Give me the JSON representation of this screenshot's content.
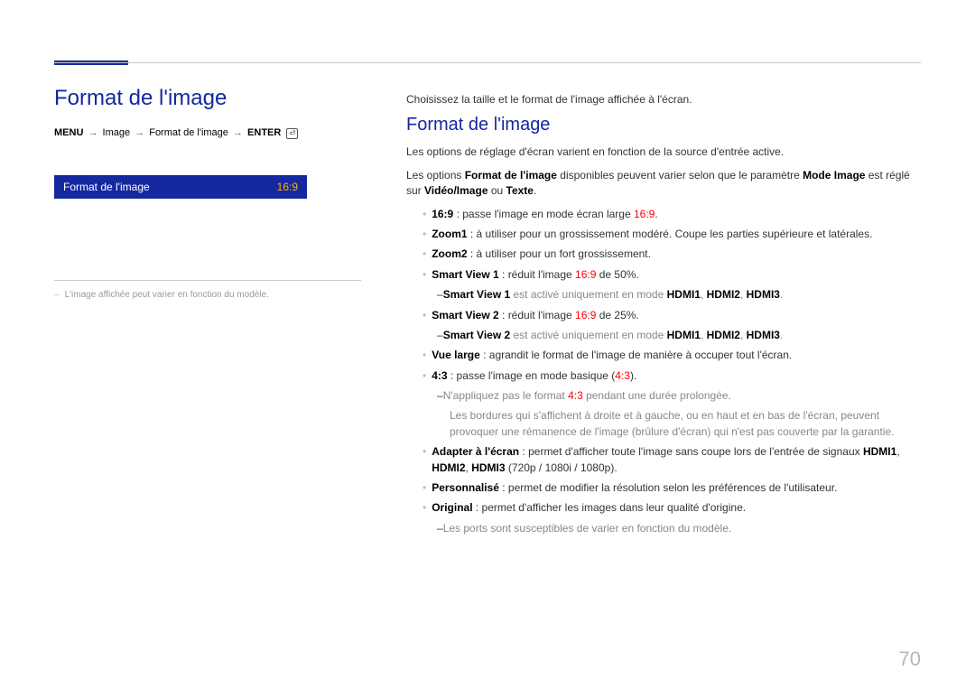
{
  "page_number": "70",
  "left": {
    "title": "Format de l'image",
    "path_menu": "MENU",
    "path_seg1": "Image",
    "path_seg2": "Format de l'image",
    "path_enter": "ENTER",
    "menu_label": "Format de l'image",
    "menu_value": "16:9",
    "note": "L'image affichée peut varier en fonction du modèle."
  },
  "right": {
    "intro": "Choisissez la taille et le format de l'image affichée à l'écran.",
    "subtitle": "Format de l'image",
    "desc": "Les options de réglage d'écran varient en fonction de la source d'entrée active.",
    "opt_line_a": "Les options ",
    "opt_line_b": "Format de l'image",
    "opt_line_c": " disponibles peuvent varier selon que le paramètre ",
    "opt_line_d": "Mode Image",
    "opt_line_e": " est réglé sur ",
    "opt_line_f": "Vidéo/Image",
    "opt_line_g": " ou ",
    "opt_line_h": "Texte",
    "opt_line_i": ".",
    "items": [
      {
        "label": "16:9",
        "text": " : passe l'image en mode écran large ",
        "val": "16:9",
        "tail": "."
      },
      {
        "label": "Zoom1",
        "text": " : à utiliser pour un grossissement modéré. Coupe les parties supérieure et latérales."
      },
      {
        "label": "Zoom2",
        "text": " : à utiliser pour un fort grossissement."
      },
      {
        "label": "Smart View 1",
        "text": " : réduit l'image ",
        "val": "16:9",
        "tail": " de 50%."
      }
    ],
    "note1_a": "Smart View 1",
    "note1_b": " est activé uniquement en mode ",
    "note1_c": "HDMI1",
    "note1_d": ", ",
    "note1_e": "HDMI2",
    "note1_f": ", ",
    "note1_g": "HDMI3",
    "note1_h": ".",
    "item5_label": "Smart View 2",
    "item5_text": " : réduit l'image ",
    "item5_val": "16:9",
    "item5_tail": " de 25%.",
    "note2_a": "Smart View 2",
    "note2_b": " est activé uniquement en mode ",
    "note2_c": "HDMI1",
    "note2_d": ", ",
    "note2_e": "HDMI2",
    "note2_f": ", ",
    "note2_g": "HDMI3",
    "note2_h": ".",
    "item6_label": "Vue large",
    "item6_text": " : agrandit le format de l'image de manière à occuper tout l'écran.",
    "item7_label": "4:3",
    "item7_text": " : passe l'image en mode basique (",
    "item7_val": "4:3",
    "item7_tail": ").",
    "warn_a": "N'appliquez pas le format ",
    "warn_b": "4:3",
    "warn_c": " pendant une durée prolongée.",
    "warn2": "Les bordures qui s'affichent à droite et à gauche, ou en haut et en bas de l'écran, peuvent provoquer une rémanence de l'image (brûlure d'écran) qui n'est pas couverte par la garantie.",
    "item8_label": "Adapter à l'écran",
    "item8_text": " : permet d'afficher toute l'image sans coupe lors de l'entrée de signaux ",
    "item8_m1": "HDMI1",
    "item8_m2": "HDMI2",
    "item8_m3": "HDMI3",
    "item8_tail": "(720p / 1080i / 1080p).",
    "item9_label": "Personnalisé",
    "item9_text": " : permet de modifier la résolution selon les préférences de l'utilisateur.",
    "item10_label": "Original",
    "item10_text": " : permet d'afficher les images dans leur qualité d'origine.",
    "note3": "Les ports sont susceptibles de varier en fonction du modèle."
  }
}
